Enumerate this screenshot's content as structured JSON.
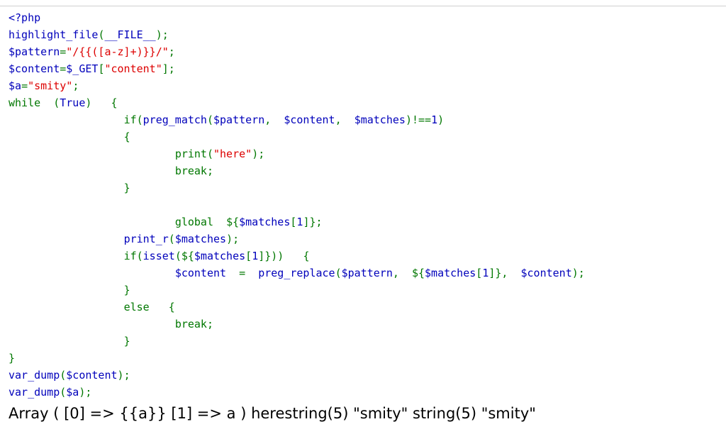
{
  "page": {
    "background_color": "#ffffff",
    "rule_color": "#cfcfcf"
  },
  "palette": {
    "default": "#0000BB",
    "keyword": "#007700",
    "string": "#DD0000",
    "comment": "#FF8000",
    "html": "#000000"
  },
  "source": {
    "language": "php",
    "lines": [
      [
        {
          "t": "<?php",
          "c": "default"
        }
      ],
      [
        {
          "t": "highlight_file",
          "c": "default"
        },
        {
          "t": "(",
          "c": "keyword"
        },
        {
          "t": "__FILE__",
          "c": "default"
        },
        {
          "t": ")",
          "c": "keyword"
        },
        {
          "t": ";",
          "c": "keyword"
        }
      ],
      [
        {
          "t": "$pattern",
          "c": "default"
        },
        {
          "t": "=",
          "c": "keyword"
        },
        {
          "t": "\"/{{([a-z]+)}}/\"",
          "c": "string"
        },
        {
          "t": ";",
          "c": "keyword"
        }
      ],
      [
        {
          "t": "$content",
          "c": "default"
        },
        {
          "t": "=",
          "c": "keyword"
        },
        {
          "t": "$_GET",
          "c": "default"
        },
        {
          "t": "[",
          "c": "keyword"
        },
        {
          "t": "\"content\"",
          "c": "string"
        },
        {
          "t": "]",
          "c": "keyword"
        },
        {
          "t": ";",
          "c": "keyword"
        }
      ],
      [
        {
          "t": "$a",
          "c": "default"
        },
        {
          "t": "=",
          "c": "keyword"
        },
        {
          "t": "\"smity\"",
          "c": "string"
        },
        {
          "t": ";",
          "c": "keyword"
        }
      ],
      [
        {
          "t": "while",
          "c": "keyword"
        },
        {
          "t": "  ",
          "c": "html"
        },
        {
          "t": "(",
          "c": "keyword"
        },
        {
          "t": "True",
          "c": "default"
        },
        {
          "t": ")",
          "c": "keyword"
        },
        {
          "t": "   ",
          "c": "html"
        },
        {
          "t": "{",
          "c": "keyword"
        }
      ],
      [
        {
          "t": "                  ",
          "c": "html"
        },
        {
          "t": "if",
          "c": "keyword"
        },
        {
          "t": "(",
          "c": "keyword"
        },
        {
          "t": "preg_match",
          "c": "default"
        },
        {
          "t": "(",
          "c": "keyword"
        },
        {
          "t": "$pattern",
          "c": "default"
        },
        {
          "t": ",",
          "c": "keyword"
        },
        {
          "t": "  ",
          "c": "html"
        },
        {
          "t": "$content",
          "c": "default"
        },
        {
          "t": ",",
          "c": "keyword"
        },
        {
          "t": "  ",
          "c": "html"
        },
        {
          "t": "$matches",
          "c": "default"
        },
        {
          "t": ")",
          "c": "keyword"
        },
        {
          "t": "!==",
          "c": "keyword"
        },
        {
          "t": "1",
          "c": "default"
        },
        {
          "t": ")",
          "c": "keyword"
        }
      ],
      [
        {
          "t": "                  ",
          "c": "html"
        },
        {
          "t": "{",
          "c": "keyword"
        }
      ],
      [
        {
          "t": "                          ",
          "c": "html"
        },
        {
          "t": "print",
          "c": "keyword"
        },
        {
          "t": "(",
          "c": "keyword"
        },
        {
          "t": "\"here\"",
          "c": "string"
        },
        {
          "t": ")",
          "c": "keyword"
        },
        {
          "t": ";",
          "c": "keyword"
        }
      ],
      [
        {
          "t": "                          ",
          "c": "html"
        },
        {
          "t": "break",
          "c": "keyword"
        },
        {
          "t": ";",
          "c": "keyword"
        }
      ],
      [
        {
          "t": "                  ",
          "c": "html"
        },
        {
          "t": "}",
          "c": "keyword"
        }
      ],
      [],
      [
        {
          "t": "                          ",
          "c": "html"
        },
        {
          "t": "global",
          "c": "keyword"
        },
        {
          "t": "  ",
          "c": "html"
        },
        {
          "t": "$",
          "c": "keyword"
        },
        {
          "t": "{",
          "c": "keyword"
        },
        {
          "t": "$matches",
          "c": "default"
        },
        {
          "t": "[",
          "c": "keyword"
        },
        {
          "t": "1",
          "c": "default"
        },
        {
          "t": "]",
          "c": "keyword"
        },
        {
          "t": "}",
          "c": "keyword"
        },
        {
          "t": ";",
          "c": "keyword"
        }
      ],
      [
        {
          "t": "                  ",
          "c": "html"
        },
        {
          "t": "print_r",
          "c": "default"
        },
        {
          "t": "(",
          "c": "keyword"
        },
        {
          "t": "$matches",
          "c": "default"
        },
        {
          "t": ")",
          "c": "keyword"
        },
        {
          "t": ";",
          "c": "keyword"
        }
      ],
      [
        {
          "t": "                  ",
          "c": "html"
        },
        {
          "t": "if",
          "c": "keyword"
        },
        {
          "t": "(",
          "c": "keyword"
        },
        {
          "t": "isset",
          "c": "default"
        },
        {
          "t": "(",
          "c": "keyword"
        },
        {
          "t": "$",
          "c": "keyword"
        },
        {
          "t": "{",
          "c": "keyword"
        },
        {
          "t": "$matches",
          "c": "default"
        },
        {
          "t": "[",
          "c": "keyword"
        },
        {
          "t": "1",
          "c": "default"
        },
        {
          "t": "]",
          "c": "keyword"
        },
        {
          "t": "}",
          "c": "keyword"
        },
        {
          "t": "))",
          "c": "keyword"
        },
        {
          "t": "   ",
          "c": "html"
        },
        {
          "t": "{",
          "c": "keyword"
        }
      ],
      [
        {
          "t": "                          ",
          "c": "html"
        },
        {
          "t": "$content",
          "c": "default"
        },
        {
          "t": "  ",
          "c": "html"
        },
        {
          "t": "=",
          "c": "keyword"
        },
        {
          "t": "  ",
          "c": "html"
        },
        {
          "t": "preg_replace",
          "c": "default"
        },
        {
          "t": "(",
          "c": "keyword"
        },
        {
          "t": "$pattern",
          "c": "default"
        },
        {
          "t": ",",
          "c": "keyword"
        },
        {
          "t": "  ",
          "c": "html"
        },
        {
          "t": "$",
          "c": "keyword"
        },
        {
          "t": "{",
          "c": "keyword"
        },
        {
          "t": "$matches",
          "c": "default"
        },
        {
          "t": "[",
          "c": "keyword"
        },
        {
          "t": "1",
          "c": "default"
        },
        {
          "t": "]",
          "c": "keyword"
        },
        {
          "t": "}",
          "c": "keyword"
        },
        {
          "t": ",",
          "c": "keyword"
        },
        {
          "t": "  ",
          "c": "html"
        },
        {
          "t": "$content",
          "c": "default"
        },
        {
          "t": ")",
          "c": "keyword"
        },
        {
          "t": ";",
          "c": "keyword"
        }
      ],
      [
        {
          "t": "                  ",
          "c": "html"
        },
        {
          "t": "}",
          "c": "keyword"
        }
      ],
      [
        {
          "t": "                  ",
          "c": "html"
        },
        {
          "t": "else",
          "c": "keyword"
        },
        {
          "t": "   ",
          "c": "html"
        },
        {
          "t": "{",
          "c": "keyword"
        }
      ],
      [
        {
          "t": "                          ",
          "c": "html"
        },
        {
          "t": "break",
          "c": "keyword"
        },
        {
          "t": ";",
          "c": "keyword"
        }
      ],
      [
        {
          "t": "                  ",
          "c": "html"
        },
        {
          "t": "}",
          "c": "keyword"
        }
      ],
      [
        {
          "t": "}",
          "c": "keyword"
        }
      ],
      [
        {
          "t": "var_dump",
          "c": "default"
        },
        {
          "t": "(",
          "c": "keyword"
        },
        {
          "t": "$content",
          "c": "default"
        },
        {
          "t": ")",
          "c": "keyword"
        },
        {
          "t": ";",
          "c": "keyword"
        }
      ],
      [
        {
          "t": "var_dump",
          "c": "default"
        },
        {
          "t": "(",
          "c": "keyword"
        },
        {
          "t": "$a",
          "c": "default"
        },
        {
          "t": ")",
          "c": "keyword"
        },
        {
          "t": ";",
          "c": "keyword"
        }
      ]
    ]
  },
  "output": {
    "text": "Array ( [0] => {{a}} [1] => a ) herestring(5) \"smity\" string(5) \"smity\""
  }
}
